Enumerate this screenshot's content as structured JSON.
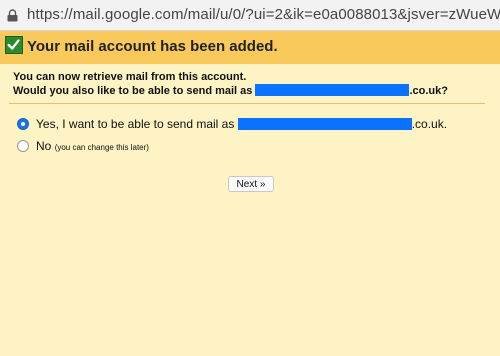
{
  "browser": {
    "url": "https://mail.google.com/mail/u/0/?ui=2&ik=e0a0088013&jsver=zWueW5..."
  },
  "banner": {
    "title": "Your mail account has been added."
  },
  "info": {
    "line1": "You can now retrieve mail from this account.",
    "line2_prefix": "Would you also like to be able to send mail as",
    "line2_suffix": ".co.uk?"
  },
  "options": {
    "yes": {
      "label": "Yes, I want to be able to send mail as",
      "suffix": ".co.uk.",
      "selected": true
    },
    "no": {
      "label": "No",
      "note": "(you can change this later)",
      "selected": false
    }
  },
  "next_button": {
    "label": "Next »"
  },
  "colors": {
    "banner": "#f9c95c",
    "panel": "#fdf3c4",
    "redaction": "#0a72ff",
    "radio_selected": "#1a73e8"
  }
}
